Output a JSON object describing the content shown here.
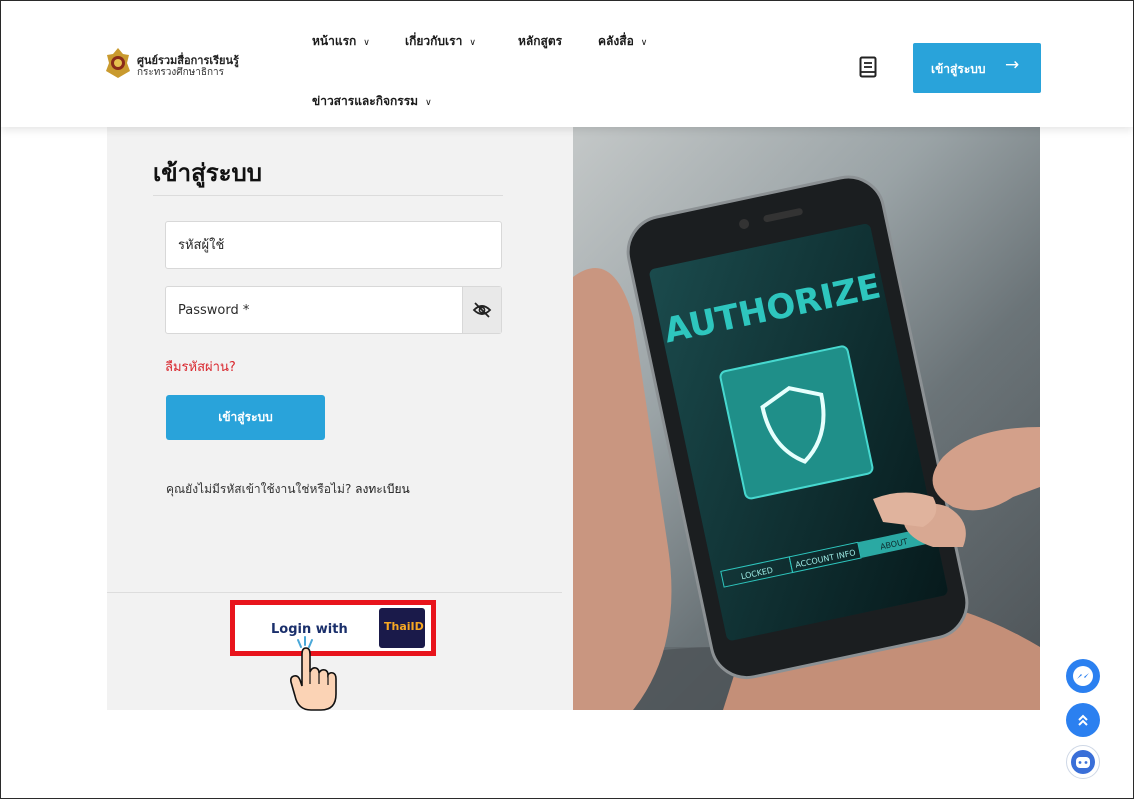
{
  "header": {
    "logo_title": "ศูนย์รวมสื่อการเรียนรู้",
    "logo_subtitle": "กระทรวงศึกษาธิการ",
    "nav": [
      {
        "label": "หน้าแรก",
        "has_dropdown": true
      },
      {
        "label": "เกี่ยวกับเรา",
        "has_dropdown": true
      },
      {
        "label": "หลักสูตร",
        "has_dropdown": false
      },
      {
        "label": "คลังสื่อ",
        "has_dropdown": true
      },
      {
        "label": "ข่าวสารและกิจกรรม",
        "has_dropdown": true
      }
    ],
    "dropdown_glyph": "∨",
    "book_icon": "book-icon",
    "login_button": {
      "label": "เข้าสู่ระบบ",
      "arrow": "→"
    }
  },
  "form": {
    "title": "เข้าสู่ระบบ",
    "username_placeholder": "รหัสผู้ใช้",
    "password_placeholder": "Password *",
    "toggle_icon": "eye-off-icon",
    "forgot_label": "ลืมรหัสผ่าน?",
    "submit_label": "เข้าสู่ระบบ",
    "register_prompt": "คุณยังไม่มีรหัสเข้าใช้งานใช่หรือไม่?",
    "register_link": "ลงทะเบียน"
  },
  "thaid": {
    "label": "Login with",
    "logo_text": "ThaiID"
  },
  "photo": {
    "screen_text": "AUTHORIZE",
    "tabs": [
      "LOCKED",
      "ACCOUNT INFO",
      "ABOUT"
    ]
  },
  "floating": {
    "messenger_icon": "messenger-icon",
    "scroll_top_icon": "chevrons-up-icon",
    "chatbot_icon": "chatbot-icon"
  },
  "colors": {
    "accent": "#29a3da",
    "forgot": "#d9272e",
    "highlight": "#e8141c",
    "screen": "#2aa9a3"
  }
}
